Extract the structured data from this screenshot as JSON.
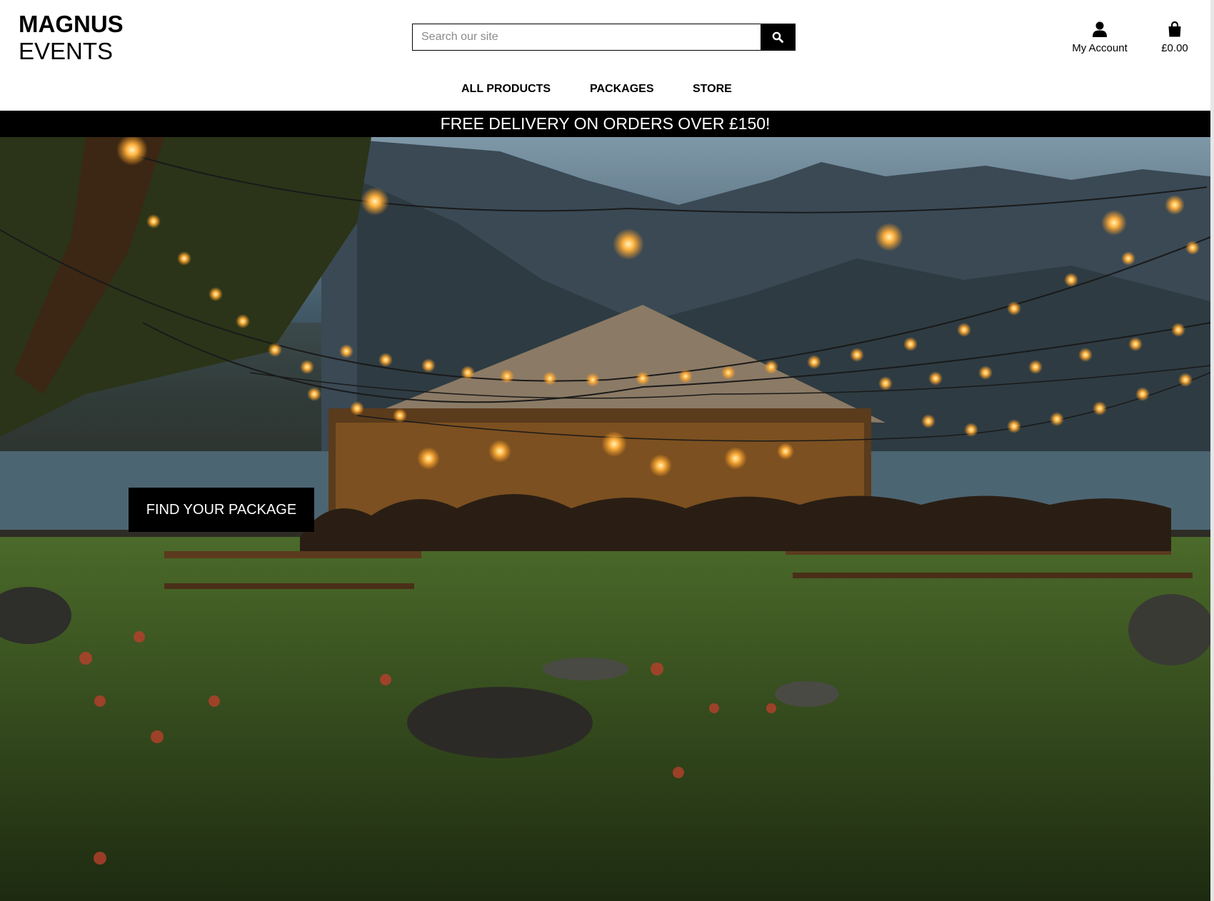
{
  "brand": {
    "line1": "MAGNUS",
    "line2": "EVENTS"
  },
  "search": {
    "placeholder": "Search our site",
    "value": ""
  },
  "account": {
    "label": "My Account"
  },
  "cart": {
    "total": "£0.00"
  },
  "nav": {
    "items": [
      {
        "label": "ALL PRODUCTS"
      },
      {
        "label": "PACKAGES"
      },
      {
        "label": "STORE"
      }
    ]
  },
  "banner": {
    "text": "FREE DELIVERY ON ORDERS OVER £150!"
  },
  "hero": {
    "cta_label": "FIND YOUR PACKAGE"
  },
  "icons": {
    "search": "search-icon",
    "account": "user-icon",
    "cart": "shopping-bag-icon"
  },
  "colors": {
    "header_bg": "#ffffff",
    "banner_bg": "#000000",
    "cta_bg": "#000000",
    "text": "#000000"
  }
}
